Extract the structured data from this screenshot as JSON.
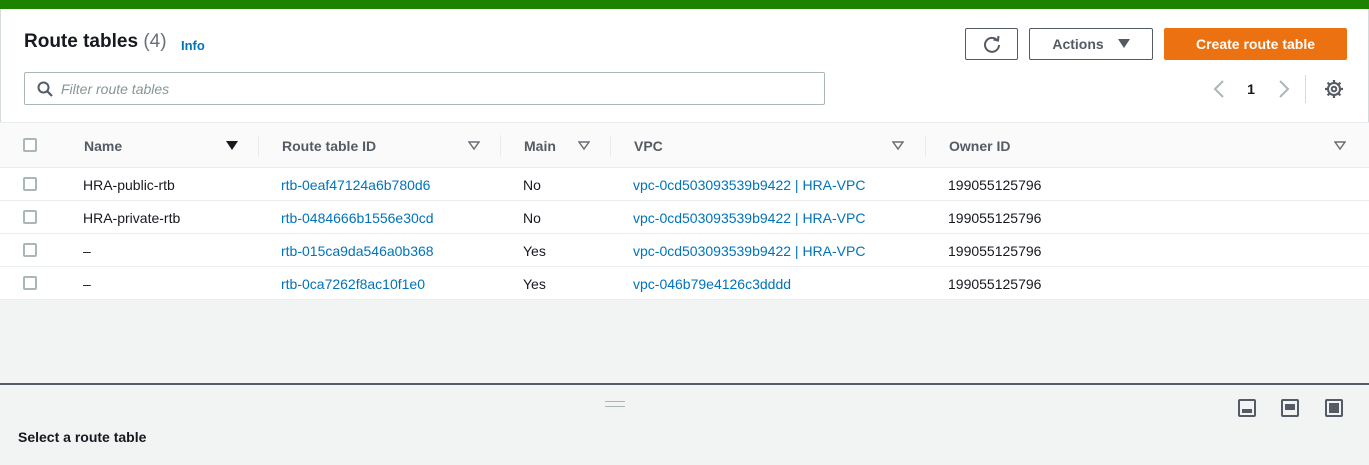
{
  "header": {
    "title": "Route tables",
    "count": "(4)",
    "info": "Info"
  },
  "toolbar": {
    "actions_label": "Actions",
    "create_label": "Create route table"
  },
  "search": {
    "placeholder": "Filter route tables"
  },
  "pagination": {
    "current_page": "1"
  },
  "columns": {
    "name": "Name",
    "route_table_id": "Route table ID",
    "main": "Main",
    "vpc": "VPC",
    "owner_id": "Owner ID"
  },
  "rows": [
    {
      "name": "HRA-public-rtb",
      "id": "rtb-0eaf47124a6b780d6",
      "main": "No",
      "vpc": "vpc-0cd503093539b9422 | HRA-VPC",
      "owner": "199055125796"
    },
    {
      "name": "HRA-private-rtb",
      "id": "rtb-0484666b1556e30cd",
      "main": "No",
      "vpc": "vpc-0cd503093539b9422 | HRA-VPC",
      "owner": "199055125796"
    },
    {
      "name": "–",
      "id": "rtb-015ca9da546a0b368",
      "main": "Yes",
      "vpc": "vpc-0cd503093539b9422 | HRA-VPC",
      "owner": "199055125796"
    },
    {
      "name": "–",
      "id": "rtb-0ca7262f8ac10f1e0",
      "main": "Yes",
      "vpc": "vpc-046b79e4126c3dddd",
      "owner": "199055125796"
    }
  ],
  "details": {
    "empty_label": "Select a route table"
  },
  "colors": {
    "success_bar": "#1d8102",
    "primary_button": "#ec7211",
    "link": "#0073bb"
  },
  "icons": [
    "refresh-icon",
    "caret-down-icon",
    "search-icon",
    "chevron-left-icon",
    "chevron-right-icon",
    "gear-icon",
    "sort-icon",
    "layout-bottom-icon",
    "layout-side-icon",
    "layout-full-icon"
  ]
}
